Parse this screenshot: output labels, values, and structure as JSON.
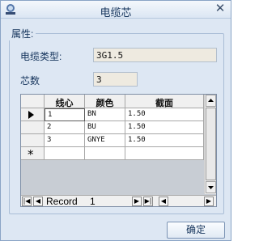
{
  "window": {
    "title": "电缆芯",
    "close_glyph": "✕"
  },
  "group": {
    "legend": "属性:"
  },
  "fields": {
    "cable_type_label": "电缆类型:",
    "cable_type_value": "3G1.5",
    "core_count_label": "芯数",
    "core_count_value": "3"
  },
  "table": {
    "columns": [
      "线心",
      "颜色",
      "截面"
    ],
    "rows": [
      {
        "core": "1",
        "color": "BN",
        "section": "1.50"
      },
      {
        "core": "2",
        "color": "BU",
        "section": "1.50"
      },
      {
        "core": "3",
        "color": "GNYE",
        "section": "1.50"
      }
    ],
    "new_row_marker": "*"
  },
  "navigator": {
    "record_label": "Record",
    "record_value": "1"
  },
  "buttons": {
    "ok_label": "确定"
  }
}
